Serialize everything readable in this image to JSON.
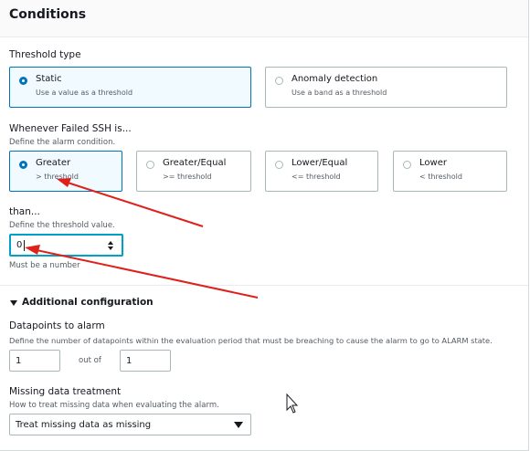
{
  "header": {
    "title": "Conditions"
  },
  "threshold_type": {
    "label": "Threshold type",
    "options": [
      {
        "title": "Static",
        "sub": "Use a value as a threshold",
        "selected": true
      },
      {
        "title": "Anomaly detection",
        "sub": "Use a band as a threshold",
        "selected": false
      }
    ]
  },
  "whenever": {
    "label": "Whenever Failed SSH is...",
    "desc": "Define the alarm condition.",
    "options": [
      {
        "title": "Greater",
        "sub": "> threshold",
        "selected": true
      },
      {
        "title": "Greater/Equal",
        "sub": ">= threshold",
        "selected": false
      },
      {
        "title": "Lower/Equal",
        "sub": "<= threshold",
        "selected": false
      },
      {
        "title": "Lower",
        "sub": "< threshold",
        "selected": false
      }
    ]
  },
  "than": {
    "label": "than...",
    "desc": "Define the threshold value.",
    "value": "0",
    "hint": "Must be a number"
  },
  "additional": {
    "label": "Additional configuration",
    "datapoints": {
      "label": "Datapoints to alarm",
      "desc": "Define the number of datapoints within the evaluation period that must be breaching to cause the alarm to go to ALARM state.",
      "value1": "1",
      "out_of": "out of",
      "value2": "1"
    },
    "missing": {
      "label": "Missing data treatment",
      "desc": "How to treat missing data when evaluating the alarm.",
      "selected": "Treat missing data as missing"
    }
  },
  "colors": {
    "accent": "#0073bb",
    "focus": "#00a1c9",
    "arrow": "#e0201b"
  }
}
